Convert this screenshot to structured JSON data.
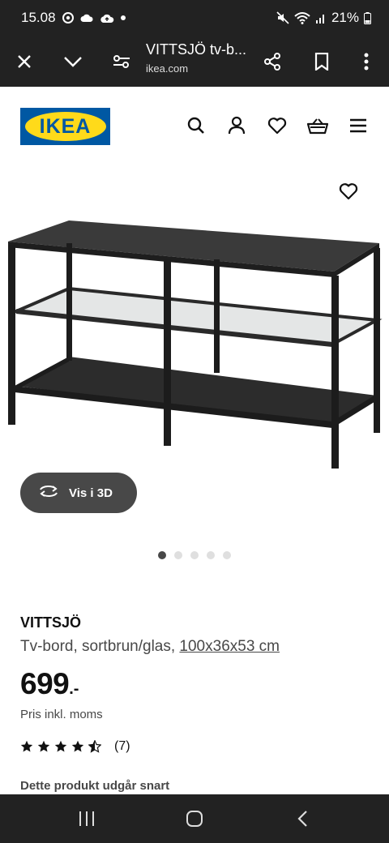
{
  "status_bar": {
    "time": "15.08",
    "battery": "21%",
    "icons": [
      "chrome-icon",
      "cloud-icon",
      "cloud-upload-icon",
      "dot-icon",
      "mute-icon",
      "wifi-icon",
      "signal-icon",
      "battery-icon"
    ]
  },
  "browser": {
    "title": "VITTSJÖ tv-b...",
    "domain": "ikea.com",
    "icons": [
      "close-icon",
      "chevron-down-icon",
      "tune-icon",
      "share-icon",
      "bookmark-icon",
      "more-vert-icon"
    ]
  },
  "header": {
    "logo_text": "IKEA",
    "logo_colors": {
      "blue": "#0058a3",
      "yellow": "#ffda1a"
    },
    "icons": [
      "search-icon",
      "account-icon",
      "heart-icon",
      "basket-icon",
      "menu-icon"
    ]
  },
  "product": {
    "image_alt": "VITTSJÖ",
    "view_3d_label": "Vis i 3D",
    "carousel_total": 5,
    "carousel_active": 1,
    "name": "VITTSJÖ",
    "desc": "Tv-bord, sortbrun/glas,",
    "dims": "100x36x53 cm",
    "price": "699",
    "price_suffix": ".-",
    "vat_note": "Pris inkl. moms",
    "rating": 4.5,
    "rating_max": 5,
    "review_count": "(7)",
    "notice": "Dette produkt udgår snart"
  },
  "system_nav": {
    "icons": [
      "recent-apps-icon",
      "home-icon",
      "back-icon"
    ]
  }
}
